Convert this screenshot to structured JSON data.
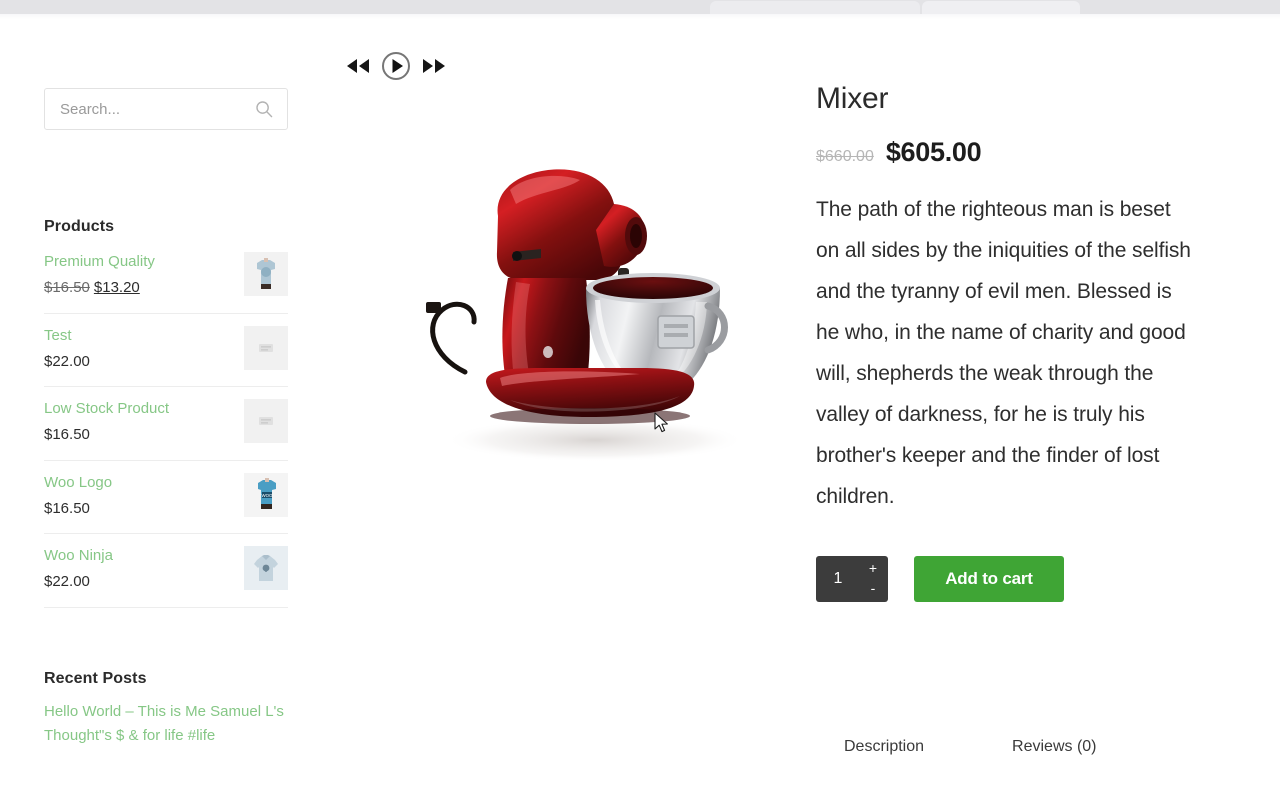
{
  "browser": {
    "tab_strip_present": true
  },
  "sidebar": {
    "search": {
      "placeholder": "Search...",
      "value": "",
      "icon": "search-icon"
    },
    "products_widget": {
      "title": "Products",
      "items": [
        {
          "name": "Premium Quality",
          "price_old": "$16.50",
          "price_new": "$13.20",
          "on_sale": true,
          "thumb": "gray-tshirt-thumb"
        },
        {
          "name": "Test",
          "price_old": "",
          "price_new": "$22.00",
          "on_sale": false,
          "thumb": "placeholder-thumb"
        },
        {
          "name": "Low Stock Product",
          "price_old": "",
          "price_new": "$16.50",
          "on_sale": false,
          "thumb": "placeholder-thumb"
        },
        {
          "name": "Woo Logo",
          "price_old": "",
          "price_new": "$16.50",
          "on_sale": false,
          "thumb": "woo-logo-shirt-thumb"
        },
        {
          "name": "Woo Ninja",
          "price_old": "",
          "price_new": "$22.00",
          "on_sale": false,
          "thumb": "woo-ninja-shirt-thumb"
        }
      ]
    },
    "posts_widget": {
      "title": "Recent Posts",
      "items": [
        {
          "title": "Hello World – This is Me Samuel L's Thought\"s $ & for life #life"
        }
      ]
    }
  },
  "gallery": {
    "prev_label": "previous-image",
    "play_label": "play-slideshow",
    "next_label": "next-image",
    "image_alt": "red stand mixer"
  },
  "product": {
    "title": "Mixer",
    "price_old": "$660.00",
    "price_new": "$605.00",
    "description": "The path of the righteous man is beset on all sides by the iniquities of the selfish and the tyranny of evil men. Blessed is he who, in the name of charity and good will, shepherds the weak through the valley of darkness, for he is truly his brother's keeper and the finder of lost children.",
    "quantity": "1",
    "qty_increase": "+",
    "qty_decrease": "-",
    "add_to_cart_label": "Add to cart",
    "tabs": [
      {
        "label": "Description",
        "active": true
      },
      {
        "label": "Reviews (0)",
        "active": false
      }
    ]
  },
  "colors": {
    "accent_green": "#3fa535",
    "link_green": "#86c786",
    "qty_dark": "#3c3c3c",
    "text_dark": "#2b2b2b",
    "muted": "#b6b6b6"
  }
}
